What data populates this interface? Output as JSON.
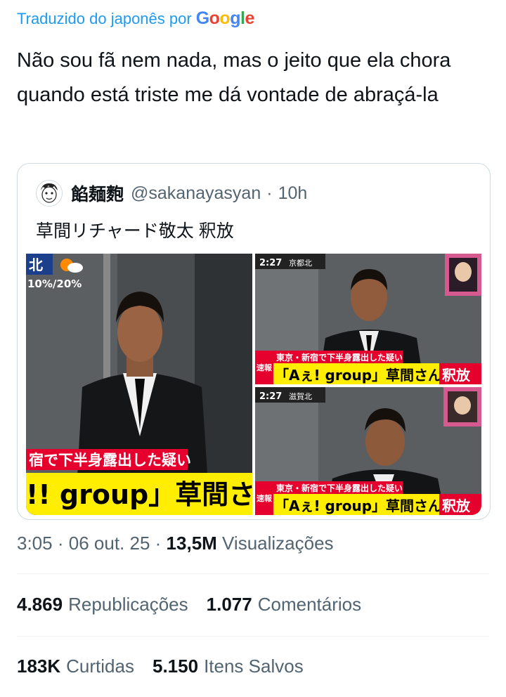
{
  "translation": {
    "label": "Traduzido do japonês por",
    "brand": "Google"
  },
  "tweet": {
    "text": "Não sou fã nem nada, mas o jeito que ela chora quando está triste me dá vontade de abraçá-la"
  },
  "quoted_tweet": {
    "display_name": "餡麺麭",
    "handle": "@sakanayasyan",
    "separator": "·",
    "time": "10h",
    "text": "草間リチャード敬太 釈放",
    "images": [
      {
        "alt_icon": "news-photo-1",
        "caption_top": "宿で下半身露出した疑い",
        "caption_main": "!! group」草間さ",
        "corner": "北",
        "weather": "10%/20%"
      },
      {
        "alt_icon": "news-photo-2",
        "time": "2:27",
        "location": "京都北",
        "banner_left": "速報",
        "banner_top": "東京・新宿で下半身露出した疑い",
        "banner_main": "「Aぇ! group」草間さん",
        "banner_right": "釈放"
      },
      {
        "alt_icon": "news-photo-3",
        "time": "2:27",
        "location": "滋賀北",
        "banner_left": "速報",
        "banner_top": "東京・新宿で下半身露出した疑い",
        "banner_main": "「Aぇ! group」草間さん",
        "banner_right": "釈放"
      }
    ]
  },
  "meta": {
    "time": "3:05",
    "date": "06 out. 25",
    "views_count": "13,5M",
    "views_label": "Visualizações",
    "sep": "·"
  },
  "stats": {
    "reposts": {
      "count": "4.869",
      "label": "Republicações"
    },
    "comments": {
      "count": "1.077",
      "label": "Comentários"
    },
    "likes": {
      "count": "183K",
      "label": "Curtidas"
    },
    "bookmarks": {
      "count": "5.150",
      "label": "Itens Salvos"
    }
  },
  "colors": {
    "link": "#1d9bf0",
    "text": "#0f1419",
    "secondary": "#536471",
    "border": "#cfd9de",
    "news_red": "#e6002d",
    "news_yellow": "#ffee00"
  }
}
